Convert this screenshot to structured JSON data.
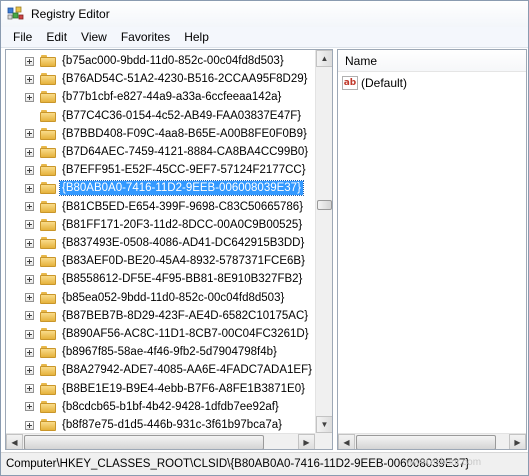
{
  "window": {
    "title": "Registry Editor",
    "icon": "regedit-icon"
  },
  "menu": [
    "File",
    "Edit",
    "View",
    "Favorites",
    "Help"
  ],
  "tree": {
    "selected_index": 7,
    "items": [
      {
        "label": "{b75ac000-9bdd-11d0-852c-00c04fd8d503}",
        "expandable": true
      },
      {
        "label": "{B76AD54C-51A2-4230-B516-2CCAA95F8D29}",
        "expandable": true
      },
      {
        "label": "{b77b1cbf-e827-44a9-a33a-6ccfeeaa142a}",
        "expandable": true
      },
      {
        "label": "{B77C4C36-0154-4c52-AB49-FAA03837E47F}",
        "expandable": false
      },
      {
        "label": "{B7BBD408-F09C-4aa8-B65E-A00B8FE0F0B9}",
        "expandable": true
      },
      {
        "label": "{B7D64AEC-7459-4121-8884-CA8BA4CC99B0}",
        "expandable": true
      },
      {
        "label": "{B7EFF951-E52F-45CC-9EF7-57124F2177CC}",
        "expandable": true
      },
      {
        "label": "{B80AB0A0-7416-11D2-9EEB-006008039E37}",
        "expandable": true
      },
      {
        "label": "{B81CB5ED-E654-399F-9698-C83C50665786}",
        "expandable": true
      },
      {
        "label": "{B81FF171-20F3-11d2-8DCC-00A0C9B00525}",
        "expandable": true
      },
      {
        "label": "{B837493E-0508-4086-AD41-DC642915B3DD}",
        "expandable": true
      },
      {
        "label": "{B83AEF0D-BE20-45A4-8932-5787371FCE6B}",
        "expandable": true
      },
      {
        "label": "{B8558612-DF5E-4F95-BB81-8E910B327FB2}",
        "expandable": true
      },
      {
        "label": "{b85ea052-9bdd-11d0-852c-00c04fd8d503}",
        "expandable": true
      },
      {
        "label": "{B87BEB7B-8D29-423F-AE4D-6582C10175AC}",
        "expandable": true
      },
      {
        "label": "{B890AF56-AC8C-11D1-8CB7-00C04FC3261D}",
        "expandable": true
      },
      {
        "label": "{b8967f85-58ae-4f46-9fb2-5d7904798f4b}",
        "expandable": true
      },
      {
        "label": "{B8A27942-ADE7-4085-AA6E-4FADC7ADA1EF}",
        "expandable": true
      },
      {
        "label": "{B8BE1E19-B9E4-4ebb-B7F6-A8FE1B3871E0}",
        "expandable": true
      },
      {
        "label": "{b8cdcb65-b1bf-4b42-9428-1dfdb7ee92af}",
        "expandable": true
      },
      {
        "label": "{b8f87e75-d1d5-446b-931c-3f61b97bca7a}",
        "expandable": true
      }
    ]
  },
  "list": {
    "column_name": "Name",
    "values": [
      {
        "icon": "string-value-icon",
        "icon_text": "ab",
        "name": "(Default)"
      }
    ]
  },
  "status": {
    "path": "Computer\\HKEY_CLASSES_ROOT\\CLSID\\{B80AB0A0-7416-11D2-9EEB-006008039E37}"
  },
  "watermark": "www.eskonr.com",
  "colors": {
    "selection": "#3399ff",
    "folder": "#e5b23c"
  }
}
